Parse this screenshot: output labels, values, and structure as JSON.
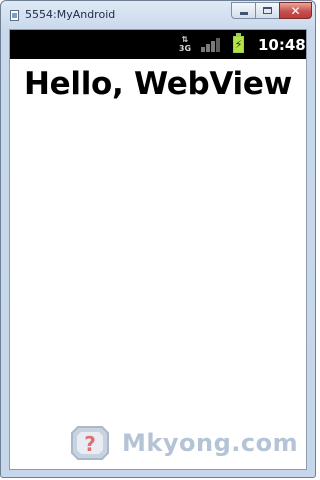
{
  "window": {
    "title": "5554:MyAndroid",
    "icon": "emulator-app-icon",
    "close_glyph": "✕"
  },
  "status_bar": {
    "network_type": "3G",
    "signal_icon": "signal-strength-icon",
    "battery_icon": "battery-charging-icon",
    "time": "10:48"
  },
  "webview": {
    "heading": "Hello, WebView"
  },
  "watermark": {
    "text": "Mkyong.com",
    "icon": "question-mark-logo",
    "color": "#a9b9cf"
  }
}
